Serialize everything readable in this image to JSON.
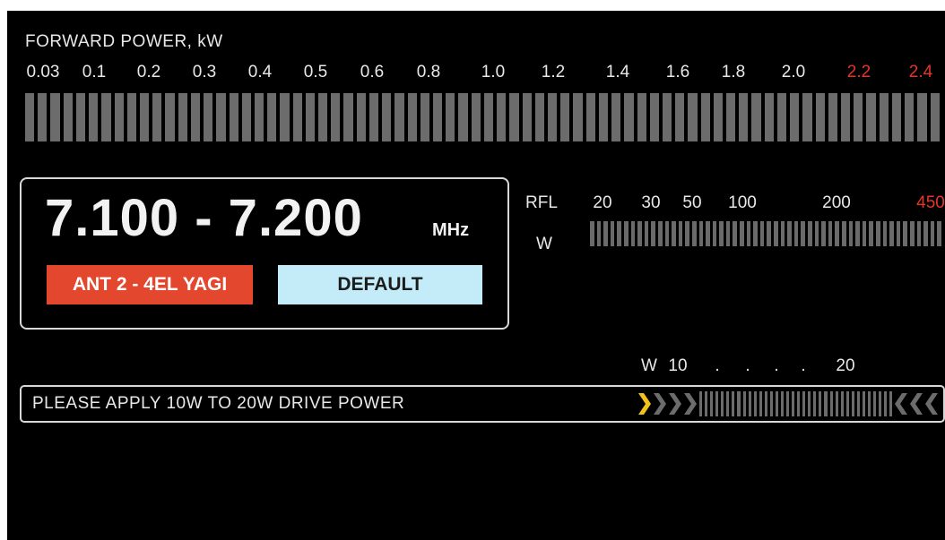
{
  "forward_power": {
    "title": "FORWARD POWER, kW",
    "ticks": [
      {
        "label": "0.03",
        "color": "#e8e8e8"
      },
      {
        "label": "0.1",
        "color": "#e8e8e8"
      },
      {
        "label": "0.2",
        "color": "#e8e8e8"
      },
      {
        "label": "0.3",
        "color": "#e8e8e8"
      },
      {
        "label": "0.4",
        "color": "#e8e8e8"
      },
      {
        "label": "0.5",
        "color": "#e8e8e8"
      },
      {
        "label": "0.6",
        "color": "#e8e8e8"
      },
      {
        "label": "0.8",
        "color": "#e8e8e8"
      },
      {
        "label": "1.0",
        "color": "#e8e8e8"
      },
      {
        "label": "1.2",
        "color": "#e8e8e8"
      },
      {
        "label": "1.4",
        "color": "#e8e8e8"
      },
      {
        "label": "1.6",
        "color": "#e8e8e8"
      },
      {
        "label": "1.8",
        "color": "#e8e8e8"
      },
      {
        "label": "2.0",
        "color": "#e8e8e8"
      },
      {
        "label": "2.2",
        "color": "#e6342a"
      },
      {
        "label": "2.4",
        "color": "#e6342a"
      }
    ],
    "level": 0
  },
  "band": {
    "frequency": "7.100 - 7.200",
    "unit": "MHz",
    "antenna": "ANT 2 - 4EL YAGI",
    "default_label": "DEFAULT"
  },
  "reflected_power": {
    "label": "RFL",
    "unit": "W",
    "ticks": [
      {
        "label": "20",
        "color": "#e8e8e8"
      },
      {
        "label": "30",
        "color": "#e8e8e8"
      },
      {
        "label": "50",
        "color": "#e8e8e8"
      },
      {
        "label": "100",
        "color": "#e8e8e8"
      },
      {
        "label": "200",
        "color": "#e8e8e8"
      },
      {
        "label": "450",
        "color": "#e6342a"
      }
    ],
    "level": 0
  },
  "drive_power": {
    "scale": [
      {
        "label": "W",
        "color": "#e8e8e8"
      },
      {
        "label": "10",
        "color": "#e8e8e8"
      },
      {
        "label": ".",
        "color": "#e8e8e8"
      },
      {
        "label": ".",
        "color": "#e8e8e8"
      },
      {
        "label": ".",
        "color": "#e8e8e8"
      },
      {
        "label": ".",
        "color": "#e8e8e8"
      },
      {
        "label": "20",
        "color": "#e8e8e8"
      }
    ],
    "message": "PLEASE APPLY 10W TO 20W DRIVE POWER",
    "indicator_color": "#f2c21b"
  },
  "colors": {
    "alert": "#e6342a",
    "antenna_badge": "#e3472e",
    "default_button": "#c4ecf8",
    "segment": "#6c6c6c"
  }
}
